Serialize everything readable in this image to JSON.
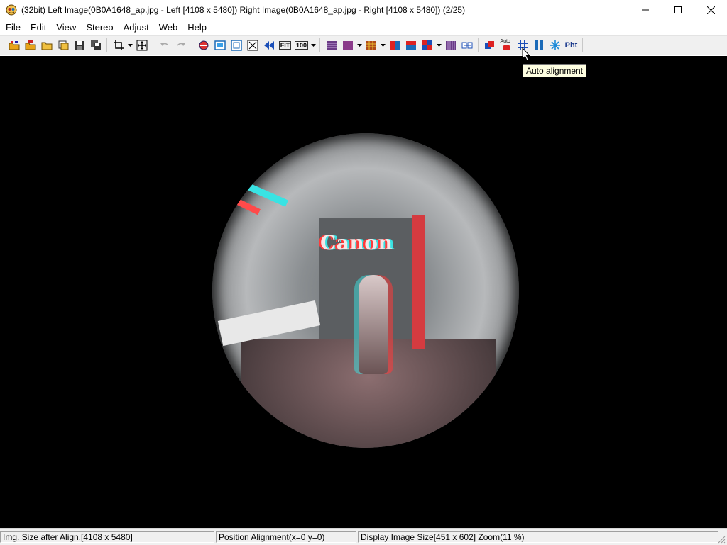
{
  "window": {
    "title": "(32bit) Left Image(0B0A1648_ap.jpg - Left [4108 x 5480]) Right Image(0B0A1648_ap.jpg - Right [4108 x 5480])  (2/25)",
    "app_icon": "stereophoto-maker-icon",
    "controls": [
      "minimize-icon",
      "maximize-icon",
      "close-icon"
    ]
  },
  "menu": {
    "items": [
      "File",
      "Edit",
      "View",
      "Stereo",
      "Adjust",
      "Web",
      "Help"
    ]
  },
  "toolbar": {
    "fit_label": "FIT",
    "zoom100_label": "100",
    "auto_label": "Auto",
    "pht_label": "Pht",
    "icons": [
      "open-left-right-icon",
      "open-stereo-icon",
      "open-folder-icon",
      "open-multi-icon",
      "save-icon",
      "save-all-icon",
      "crop-icon",
      "move-icon",
      "undo-icon",
      "redo-icon",
      "swap-icon",
      "window-icon",
      "frame-icon",
      "fullscreen-icon",
      "back-icon",
      "fit-icon",
      "zoom100-icon",
      "interlaced-icon",
      "color-anaglyph-icon",
      "dubois-anaglyph-icon",
      "side-by-side-icon",
      "red-cyan-icon",
      "checker-icon",
      "pattern-icon",
      "flip-icon",
      "easy-adjust-icon",
      "auto-alignment-icon",
      "grid-icon",
      "pillar-icon",
      "snowflake-icon",
      "pht-icon"
    ]
  },
  "tooltip": {
    "text": "Auto alignment"
  },
  "image": {
    "logo_text": "Canon",
    "description_name": "anaglyph-fisheye-image"
  },
  "status": {
    "size_after_align": "Img. Size after Align.[4108 x 5480]",
    "position_alignment": "Position Alignment(x=0 y=0)",
    "display_size": "Display Image Size[451 x 602]  Zoom(11 %)"
  },
  "colors": {
    "anaglyph_red": "#ff3b3b",
    "anaglyph_cyan": "#39e3e3",
    "tooltip_bg": "#ffffe1",
    "toolbar_bg": "#f0f0f0"
  }
}
